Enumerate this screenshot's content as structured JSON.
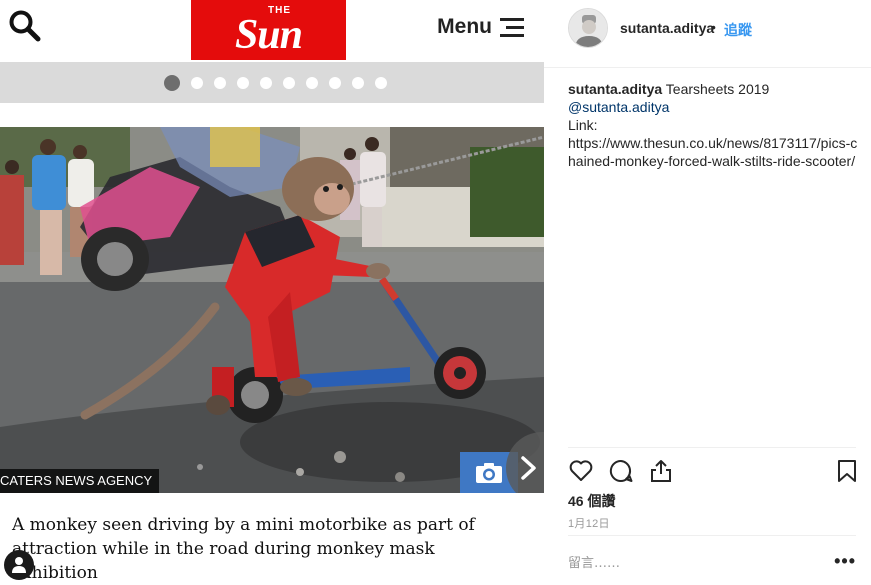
{
  "article": {
    "logo_the": "THE",
    "logo_name": "Sun",
    "menu_label": "Menu",
    "carousel": {
      "total": 10,
      "active_index": 0
    },
    "photo_credit": "CATERS NEWS AGENCY",
    "caption": "A monkey seen driving by a mini motorbike as part of attraction while in the road during monkey mask exhibition",
    "icons": {
      "search": "search-icon",
      "menu": "hamburger-icon",
      "camera": "camera-icon",
      "next": "chevron-right-icon",
      "user": "user-icon"
    },
    "colors": {
      "brand_red": "#e40c0c",
      "camera_blue": "#3f78c4",
      "strip_gray": "#dadada"
    }
  },
  "panel": {
    "username": "sutanta.aditya",
    "separator": "•",
    "follow_label": "追蹤",
    "post": {
      "owner": "sutanta.aditya",
      "title": "Tearsheets 2019",
      "mention": "@sutanta.aditya",
      "link_label": "Link:",
      "link_url": "https://www.thesun.co.uk/news/8173117/pics-chained-monkey-forced-walk-stilts-ride-scooter/"
    },
    "likes": "46 個讚",
    "date": "1月12日",
    "comment_placeholder": "留言……",
    "more_label": "•••",
    "icons": {
      "like": "heart-icon",
      "comment": "comment-icon",
      "share": "share-icon",
      "save": "bookmark-icon",
      "more": "more-icon"
    },
    "colors": {
      "follow_blue": "#3897f0",
      "mention_blue": "#003569",
      "muted": "#999999"
    }
  }
}
